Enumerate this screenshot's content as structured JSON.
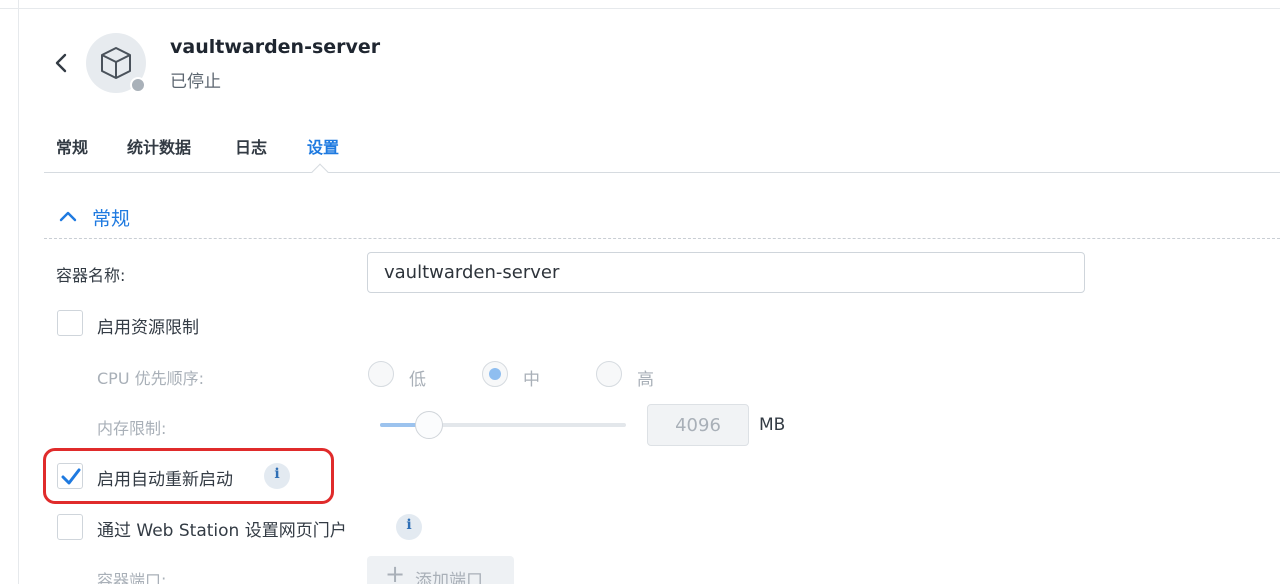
{
  "header": {
    "app_name": "vaultwarden-server",
    "status": "已停止"
  },
  "tabs": [
    {
      "label": "常规",
      "active": false
    },
    {
      "label": "统计数据",
      "active": false
    },
    {
      "label": "日志",
      "active": false
    },
    {
      "label": "设置",
      "active": true
    }
  ],
  "section": {
    "title": "常规",
    "expanded": true
  },
  "container_name": {
    "label": "容器名称:",
    "value": "vaultwarden-server"
  },
  "resource_limit": {
    "label": "启用资源限制",
    "checked": false
  },
  "cpu_priority": {
    "label": "CPU 优先顺序:",
    "options": [
      {
        "label": "低",
        "checked": false
      },
      {
        "label": "中",
        "checked": true
      },
      {
        "label": "高",
        "checked": false
      }
    ]
  },
  "memory_limit": {
    "label": "内存限制:",
    "value": "4096",
    "unit": "MB",
    "slider_fraction": 0.2
  },
  "auto_restart": {
    "label": "启用自动重新启动",
    "checked": true,
    "info_glyph": "i"
  },
  "web_station": {
    "label": "通过 Web Station 设置网页门户",
    "checked": false,
    "info_glyph": "i"
  },
  "container_port": {
    "label": "容器端口:",
    "add_button_label": "添加端口",
    "add_button_icon": "+"
  },
  "colors": {
    "accent": "#1f7ae0",
    "highlight": "#e02b2b",
    "stopped_dot": "#a9b1b9"
  }
}
